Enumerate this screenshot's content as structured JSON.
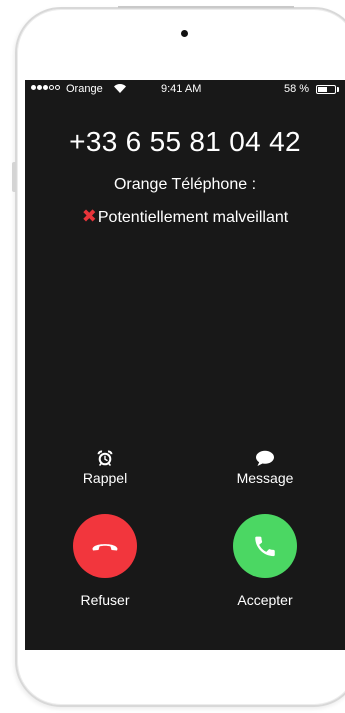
{
  "status_bar": {
    "carrier": "Orange",
    "time": "9:41 AM",
    "battery_percent": "58 %",
    "battery_level": 0.58,
    "signal_strength_dots": 3,
    "signal_total_dots": 5
  },
  "call": {
    "number": "+33 6 55 81 04 42",
    "source": "Orange Téléphone :",
    "warning_label": "Potentiellement malveillant",
    "warning_icon": "red-x-icon",
    "warning_color": "#e8343a"
  },
  "actions": {
    "remind": {
      "label": "Rappel",
      "icon": "alarm-clock-icon"
    },
    "message": {
      "label": "Message",
      "icon": "speech-bubble-icon"
    },
    "decline": {
      "label": "Refuser",
      "icon": "phone-hangup-icon",
      "color": "#f2363d"
    },
    "accept": {
      "label": "Accepter",
      "icon": "phone-icon",
      "color": "#4bd763"
    }
  },
  "colors": {
    "screen_background": "#181818",
    "text": "#ffffff"
  }
}
